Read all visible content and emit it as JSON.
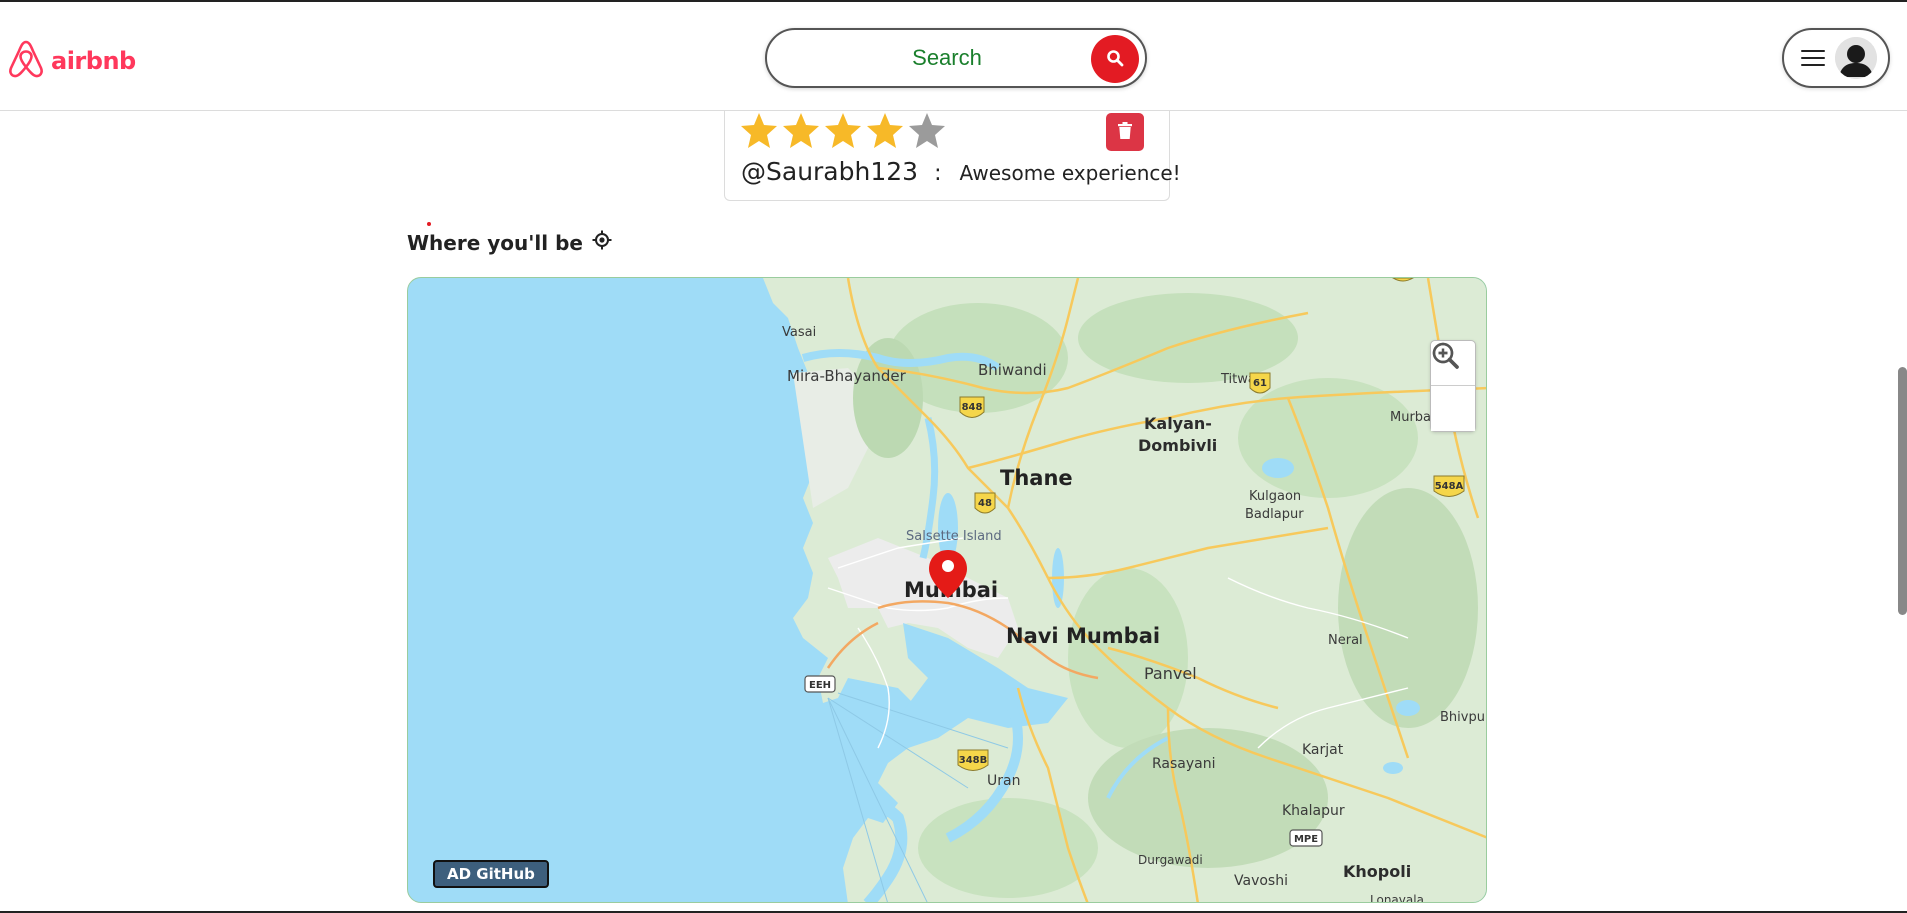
{
  "header": {
    "brand": "airbnb",
    "brand_color": "#ff385c",
    "logo_icon": "airbnb-logo-icon",
    "search": {
      "placeholder": "Search",
      "button_icon": "search-icon",
      "button_color": "#e31b23"
    },
    "profile": {
      "menu_icon": "hamburger-menu-icon",
      "avatar_icon": "user-avatar-icon"
    }
  },
  "review": {
    "rating": 4,
    "rating_max": 5,
    "star_color": "#f7b928",
    "author": "@Saurabh123",
    "separator": ":",
    "comment": "Awesome experience!",
    "delete_icon": "trash-icon",
    "delete_color": "#dc3545"
  },
  "location": {
    "title": "Where you'll be",
    "title_icon": "locate-icon"
  },
  "map": {
    "labels": {
      "vasai": "Vasai",
      "mira": "Mira-Bhayander",
      "bhiwandi": "Bhiwandi",
      "titwala": "Titwala",
      "murbad": "Murba",
      "kalyan1": "Kalyan-",
      "kalyan2": "Dombivli",
      "thane": "Thane",
      "kulgaon1": "Kulgaon",
      "kulgaon2": "Badlapur",
      "salsette": "Salsette Island",
      "mumbai": "Mumbai",
      "navi": "Navi Mumbai",
      "neral": "Neral",
      "panvel": "Panvel",
      "bhivpuri": "Bhivpu",
      "karjat": "Karjat",
      "rasayani": "Rasayani",
      "uran": "Uran",
      "khalapur": "Khalapur",
      "durgawadi": "Durgawadi",
      "vavoshi": "Vavoshi",
      "khopoli": "Khopoli",
      "lonavala": "Lonavala"
    },
    "shields": {
      "s848": "848",
      "s61": "61",
      "s48": "48",
      "s548a": "548A",
      "s348b": "348B",
      "eeh": "EEH",
      "mpe": "MPE"
    },
    "marker_icon": "map-pin-icon",
    "zoom_in_icon": "zoom-in-icon",
    "zoom_out_icon": "zoom-out-icon",
    "credit": "AD GitHub",
    "water_color": "#9fdcf7",
    "land_color": "#dcebd5"
  }
}
